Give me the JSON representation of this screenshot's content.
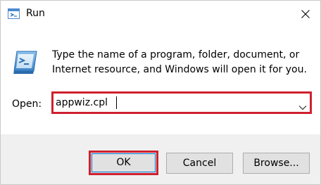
{
  "window": {
    "title": "Run",
    "title_icon": "run-icon",
    "close_icon": "close-icon"
  },
  "content": {
    "icon": "run-app-icon",
    "description": "Type the name of a program, folder, document, or Internet resource, and Windows will open it for you.",
    "open_label": "Open:",
    "input_value": "appwiz.cpl",
    "dropdown_icon": "chevron-down-icon"
  },
  "buttons": {
    "ok_label": "OK",
    "cancel_label": "Cancel",
    "browse_label": "Browse..."
  },
  "colors": {
    "highlight_border": "#d0202e",
    "footer_background": "#f0f0f0",
    "button_background": "#e1e1e1",
    "focus_blue": "#0078d7"
  }
}
